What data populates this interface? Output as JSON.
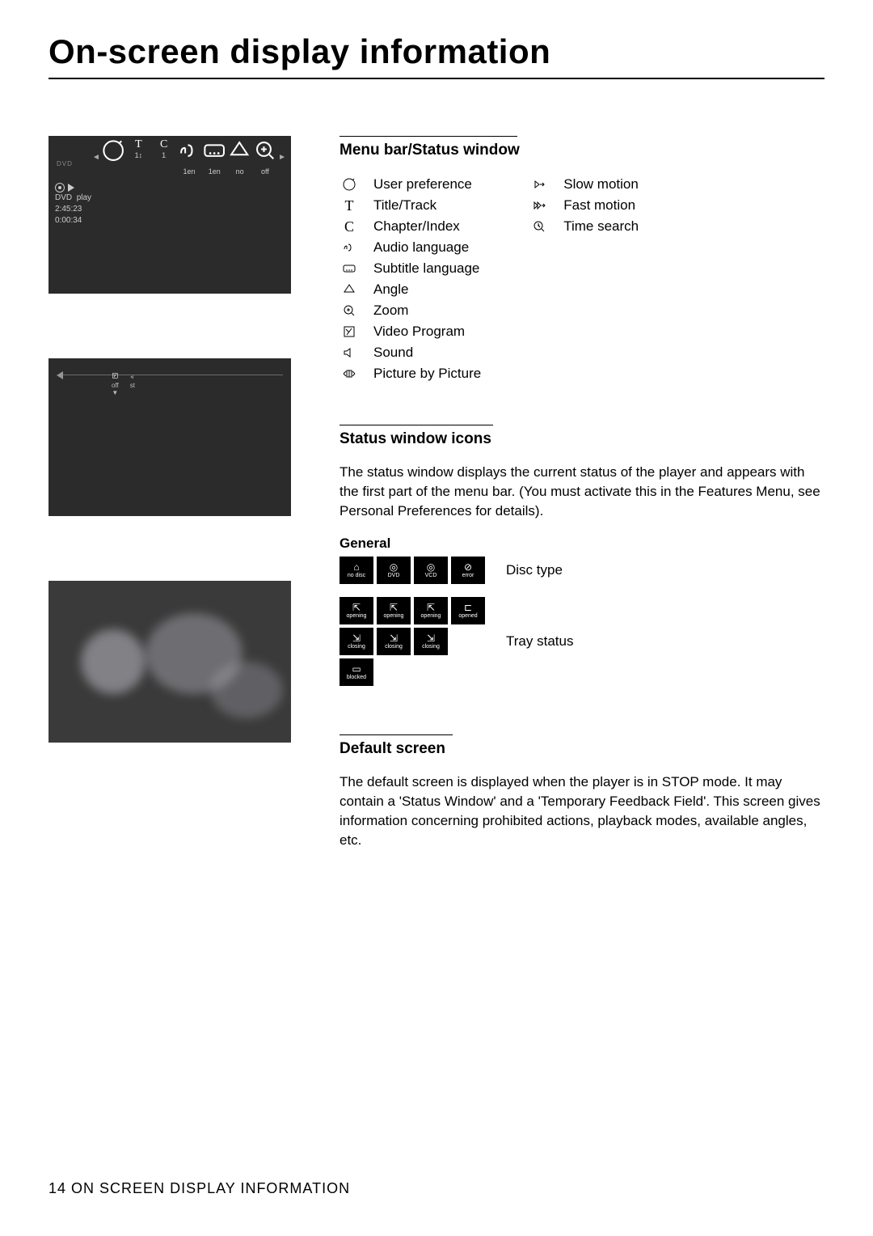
{
  "title": "On-screen display information",
  "footer": {
    "page": "14",
    "label": "ON SCREEN DISPLAY INFORMATION"
  },
  "osd1": {
    "dvd_label": "DVD",
    "menubar": {
      "items": [
        {
          "icon": "pref",
          "val": ""
        },
        {
          "icon": "T",
          "val": "1↕"
        },
        {
          "icon": "C",
          "val": "1"
        },
        {
          "icon": "audio",
          "val": "1en"
        },
        {
          "icon": "sub",
          "val": "1en"
        },
        {
          "icon": "angle",
          "val": "no"
        },
        {
          "icon": "zoom",
          "val": "off"
        }
      ]
    },
    "status": {
      "disc": "DVD",
      "mode": "play",
      "total": "2:45:23",
      "elapsed": "0:00:34"
    }
  },
  "osd2": {
    "menubar": {
      "items": [
        {
          "icon": "prog",
          "val": "off"
        },
        {
          "icon": "sound",
          "val": "st"
        },
        {
          "icon": "pbp",
          "val": ""
        },
        {
          "icon": "slow",
          "val": ""
        },
        {
          "icon": "fast",
          "val": ""
        },
        {
          "icon": "tsearch",
          "val": ""
        }
      ]
    }
  },
  "sections": {
    "menubar": {
      "heading": "Menu bar/Status window",
      "col1": [
        {
          "glyph": "pref",
          "label": "User preference"
        },
        {
          "glyph": "T",
          "label": "Title/Track"
        },
        {
          "glyph": "C",
          "label": "Chapter/Index"
        },
        {
          "glyph": "audio",
          "label": "Audio language"
        },
        {
          "glyph": "sub",
          "label": "Subtitle language"
        },
        {
          "glyph": "angle",
          "label": "Angle"
        },
        {
          "glyph": "zoom",
          "label": "Zoom"
        },
        {
          "glyph": "prog",
          "label": "Video Program"
        },
        {
          "glyph": "sound",
          "label": "Sound"
        },
        {
          "glyph": "pbp",
          "label": "Picture by Picture"
        }
      ],
      "col2": [
        {
          "glyph": "slow",
          "label": "Slow motion"
        },
        {
          "glyph": "fast",
          "label": "Fast motion"
        },
        {
          "glyph": "tsearch",
          "label": "Time search"
        }
      ]
    },
    "status_icons": {
      "heading": "Status window icons",
      "paragraph": "The status window displays the current status of the player and appears with the first part of the menu bar. (You must activate this in the Features Menu, see Personal Preferences for details).",
      "general_title": "General",
      "disc_type": {
        "boxes": [
          "no disc",
          "DVD",
          "VCD",
          "error"
        ],
        "label": "Disc type"
      },
      "tray_status": {
        "rows": [
          [
            "opening",
            "opening",
            "opening",
            "opened"
          ],
          [
            "closing",
            "closing",
            "closing"
          ],
          [
            "blocked"
          ]
        ],
        "label": "Tray status"
      }
    },
    "default_screen": {
      "heading": "Default screen",
      "paragraph": "The default screen is displayed when the player is in STOP mode. It may contain a 'Status Window' and a 'Temporary Feedback Field'. This screen gives information concerning prohibited actions, playback modes, available angles, etc."
    }
  }
}
